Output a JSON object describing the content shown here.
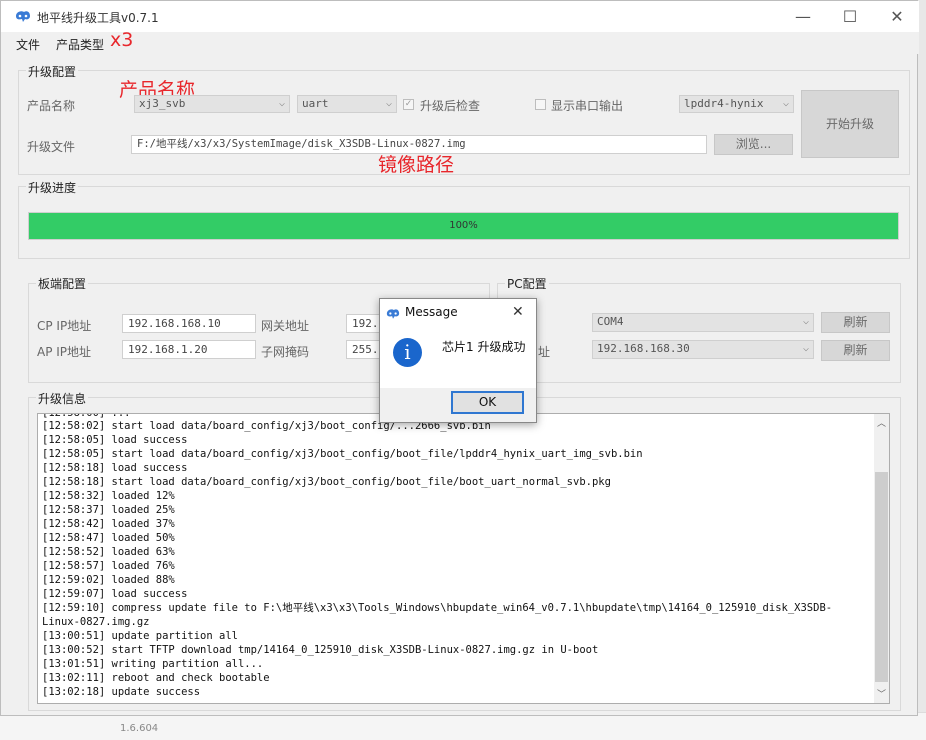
{
  "window": {
    "title": "地平线升级工具v0.7.1",
    "controls": {
      "minimize": "—",
      "maximize": "☐",
      "close": "✕"
    }
  },
  "menu": {
    "items": [
      "文件",
      "产品类型"
    ]
  },
  "annotations": {
    "product_type": "x3",
    "product_name": "产品名称",
    "image_path": "镜像路径"
  },
  "upgrade_config": {
    "title": "升级配置",
    "product_label": "产品名称",
    "product_value": "xj3_svb",
    "interface_value": "uart",
    "check_after_label": "升级后检查",
    "check_after_checked": true,
    "serial_output_label": "显示串口输出",
    "serial_output_checked": false,
    "memory_value": "lpddr4-hynix",
    "start_button": "开始升级",
    "file_label": "升级文件",
    "file_path": "F:/地平线/x3/x3/SystemImage/disk_X3SDB-Linux-0827.img",
    "browse_button": "浏览..."
  },
  "upgrade_progress": {
    "title": "升级进度",
    "percent": 100,
    "label": "100%"
  },
  "board_config": {
    "title": "板端配置",
    "cp_ip_label": "CP IP地址",
    "cp_ip_value": "192.168.168.10",
    "ap_ip_label": "AP IP地址",
    "ap_ip_value": "192.168.1.20",
    "gateway_label": "网关地址",
    "gateway_value": "192.1",
    "subnet_label": "子网掩码",
    "subnet_value": "255.2"
  },
  "pc_config": {
    "title": "PC配置",
    "port_value": "COM4",
    "ip_label_fragment": "址",
    "ip_value": "192.168.168.30",
    "refresh_button": "刷新"
  },
  "upgrade_info": {
    "title": "升级信息",
    "lines": [
      "[12:58:02] start load data/board_config/xj3/boot_config/...2666_svb.bin",
      "[12:58:05] load success",
      "[12:58:05] start load data/board_config/xj3/boot_config/boot_file/lpddr4_hynix_uart_img_svb.bin",
      "[12:58:18] load success",
      "[12:58:18] start load data/board_config/xj3/boot_config/boot_file/boot_uart_normal_svb.pkg",
      "[12:58:32] loaded 12%",
      "[12:58:37] loaded 25%",
      "[12:58:42] loaded 37%",
      "[12:58:47] loaded 50%",
      "[12:58:52] loaded 63%",
      "[12:58:57] loaded 76%",
      "[12:59:02] loaded 88%",
      "[12:59:07] load success",
      "[12:59:10] compress update file to F:\\地平线\\x3\\x3\\Tools_Windows\\hbupdate_win64_v0.7.1\\hbupdate\\tmp\\14164_0_125910_disk_X3SDB-",
      "Linux-0827.img.gz",
      "[13:00:51] update partition all",
      "[13:00:52] start TFTP download tmp/14164_0_125910_disk_X3SDB-Linux-0827.img.gz in U-boot",
      "[13:01:51] writing partition all...",
      "[13:02:11] reboot and check bootable",
      "[13:02:18] update success"
    ]
  },
  "dialog": {
    "title": "Message",
    "close": "✕",
    "icon": "info-icon",
    "icon_glyph": "i",
    "message": "芯片1 升级成功",
    "ok_button": "OK"
  },
  "background": {
    "bottom_fragment": "1.6.604"
  },
  "colors": {
    "progress": "#33cc66",
    "annotation": "#e8272c",
    "dialog_accent": "#1a66cc"
  }
}
